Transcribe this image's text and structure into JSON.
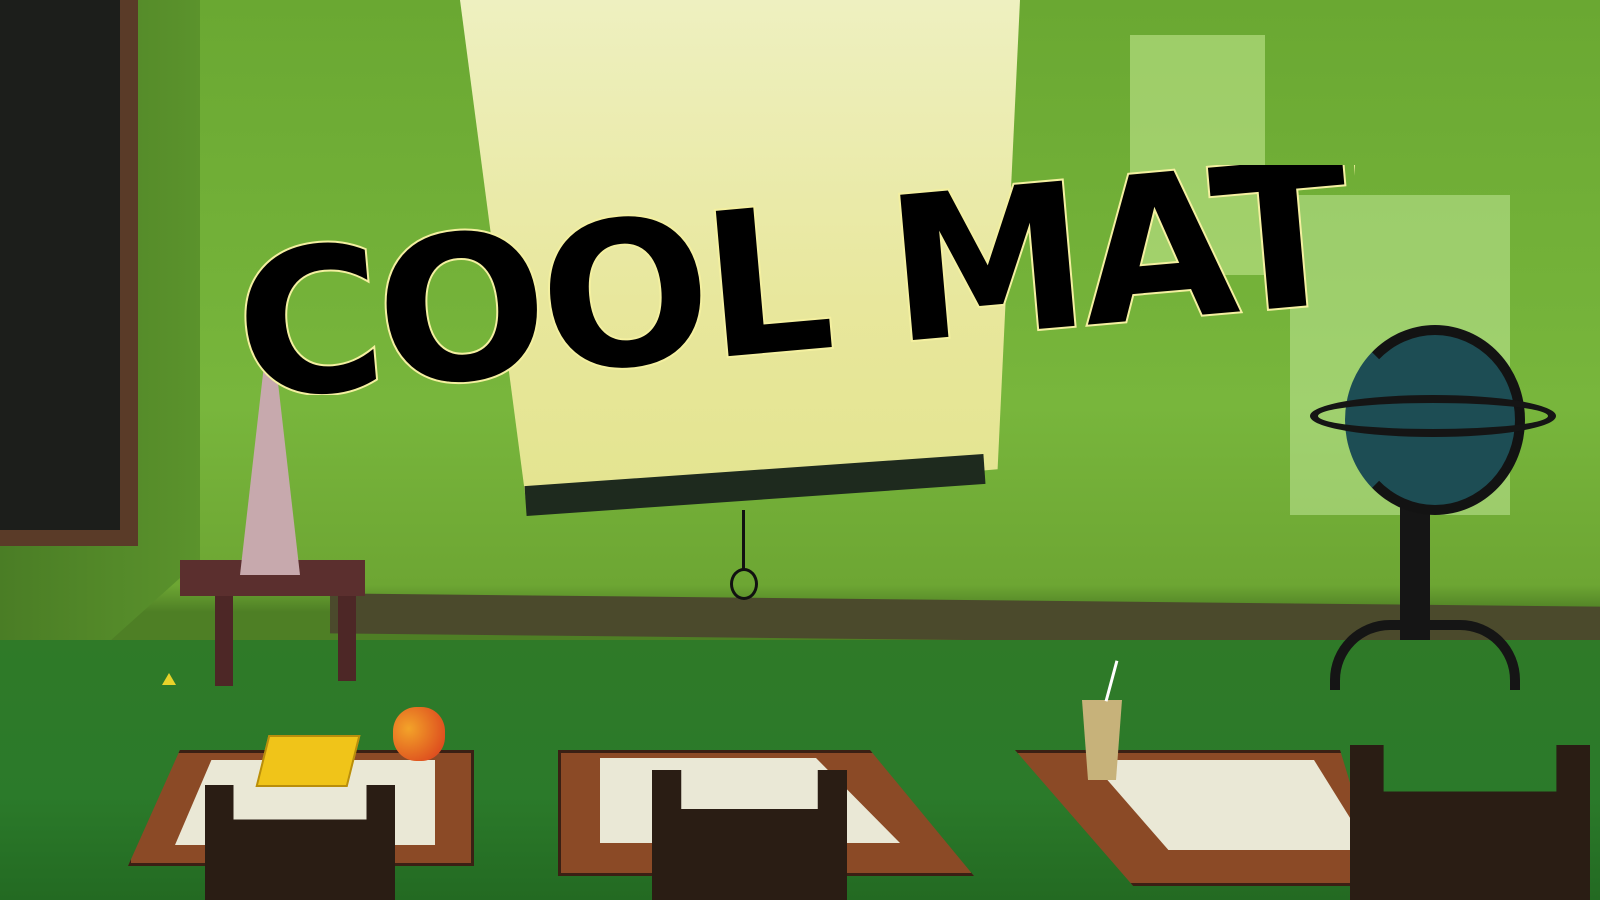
{
  "game": {
    "title_logo": "COOL MATH"
  },
  "colors": {
    "wall": "#78b63c",
    "floor": "#2b7a2a",
    "screen": "#e8e79c",
    "title_fill": "#000000",
    "title_outline": "#f4f0a0"
  }
}
